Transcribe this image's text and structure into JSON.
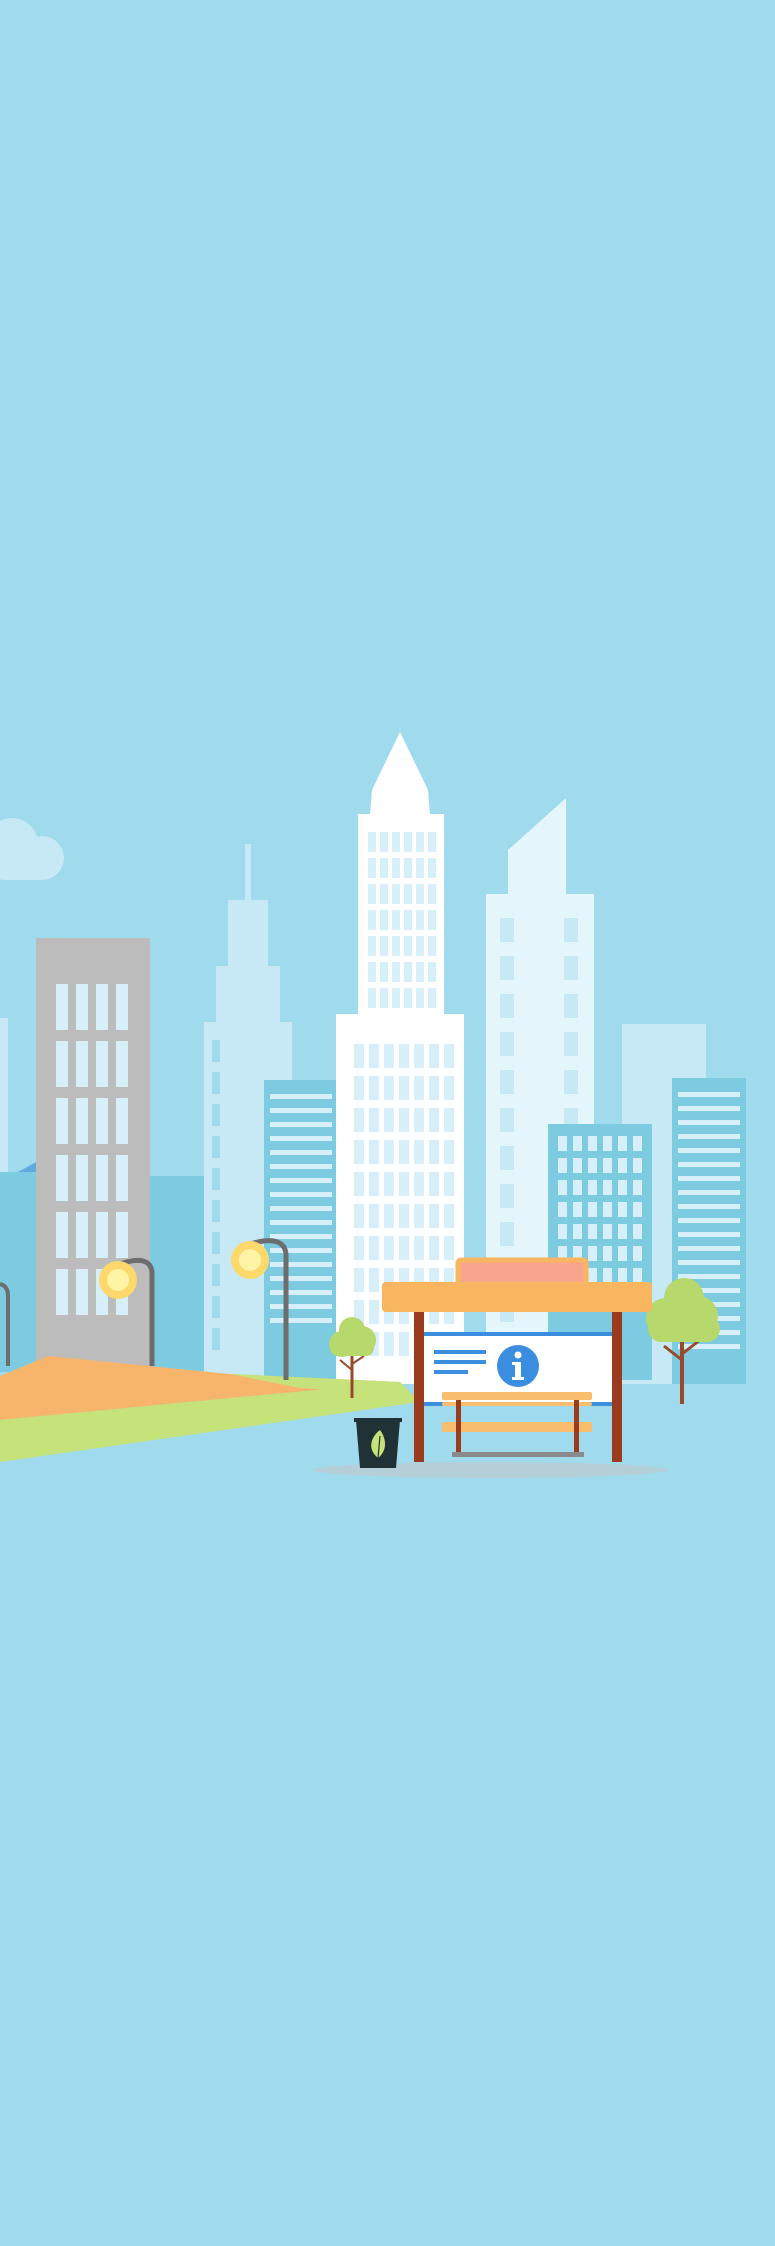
{
  "scene": {
    "sky_color": "#9fdbec",
    "white_building_color": "#ffffff",
    "pale_building_color": "#e4f6fc",
    "light_building_color": "#c6e9f5",
    "mid_building_color": "#7dcbe0",
    "gray_building_color": "#bcbcbc",
    "window_color": "#d7eff8",
    "window_light_color": "#ffffff",
    "cloud_color": "#c6e9f5",
    "lamp_pole_color": "#6d6d6d",
    "lamp_light_color": "#fff3a6",
    "lamp_glow_color": "#fcd96a",
    "grass_color": "#c6e27a",
    "path_color": "#f7b56b",
    "shadow_color": "#b4cfd8",
    "tree_foliage_color": "#b6d86c",
    "tree_trunk_color": "#9a4a2b",
    "shelter_roof_color": "#f8b660",
    "shelter_sign_color": "#f7a58d",
    "shelter_frame_color": "#9a3b1e",
    "info_panel_color": "#ffffff",
    "info_accent_color": "#3b8de0",
    "bench_color": "#f8bd6d",
    "trash_bin_color": "#213237",
    "leaf_color": "#c6e27a",
    "info_icon": "info-icon",
    "leaf_icon": "leaf-icon"
  }
}
